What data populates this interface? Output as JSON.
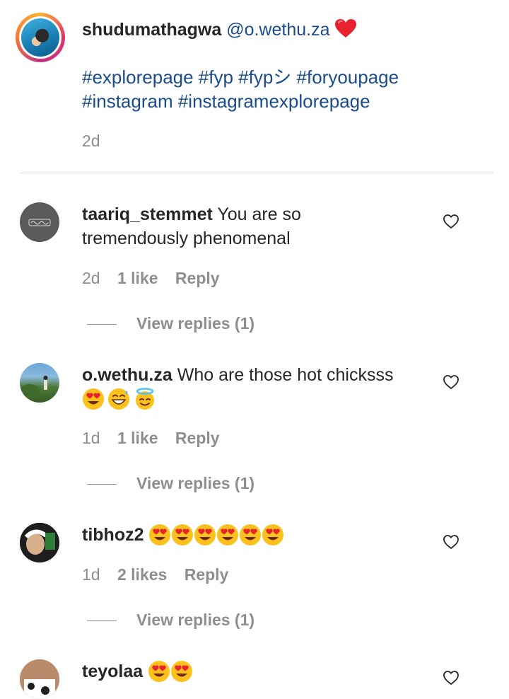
{
  "caption": {
    "username": "shudumathagwa",
    "mention": "@o.wethu.za",
    "hashtags_line1": "#explorepage #fyp #fypシ #foryoupage",
    "hashtags_line2": "#instagram #instagramexplorepage",
    "time": "2d"
  },
  "comments": [
    {
      "username": "taariq_stemmet",
      "text_line1": "You are so",
      "text_line2": "tremendously phenomenal",
      "time": "2d",
      "likes": "1 like",
      "reply": "Reply",
      "view_replies": "View replies (1)"
    },
    {
      "username": "o.wethu.za",
      "text_line1": "Who are those hot chicksss",
      "emoji_line2": [
        "heart-eyes",
        "grin-sweat",
        "halo"
      ],
      "time": "1d",
      "likes": "1 like",
      "reply": "Reply",
      "view_replies": "View replies (1)"
    },
    {
      "username": "tibhoz2",
      "emoji_line1": [
        "heart-eyes",
        "heart-eyes",
        "heart-eyes",
        "heart-eyes",
        "heart-eyes",
        "heart-eyes"
      ],
      "time": "1d",
      "likes": "2 likes",
      "reply": "Reply",
      "view_replies": "View replies (1)"
    },
    {
      "username": "teyolaa",
      "emoji_line1": [
        "heart-eyes",
        "heart-eyes"
      ]
    }
  ],
  "colors": {
    "link": "#1b4c8e",
    "meta": "#8e8e8e",
    "heart_red": "#e8222f"
  }
}
